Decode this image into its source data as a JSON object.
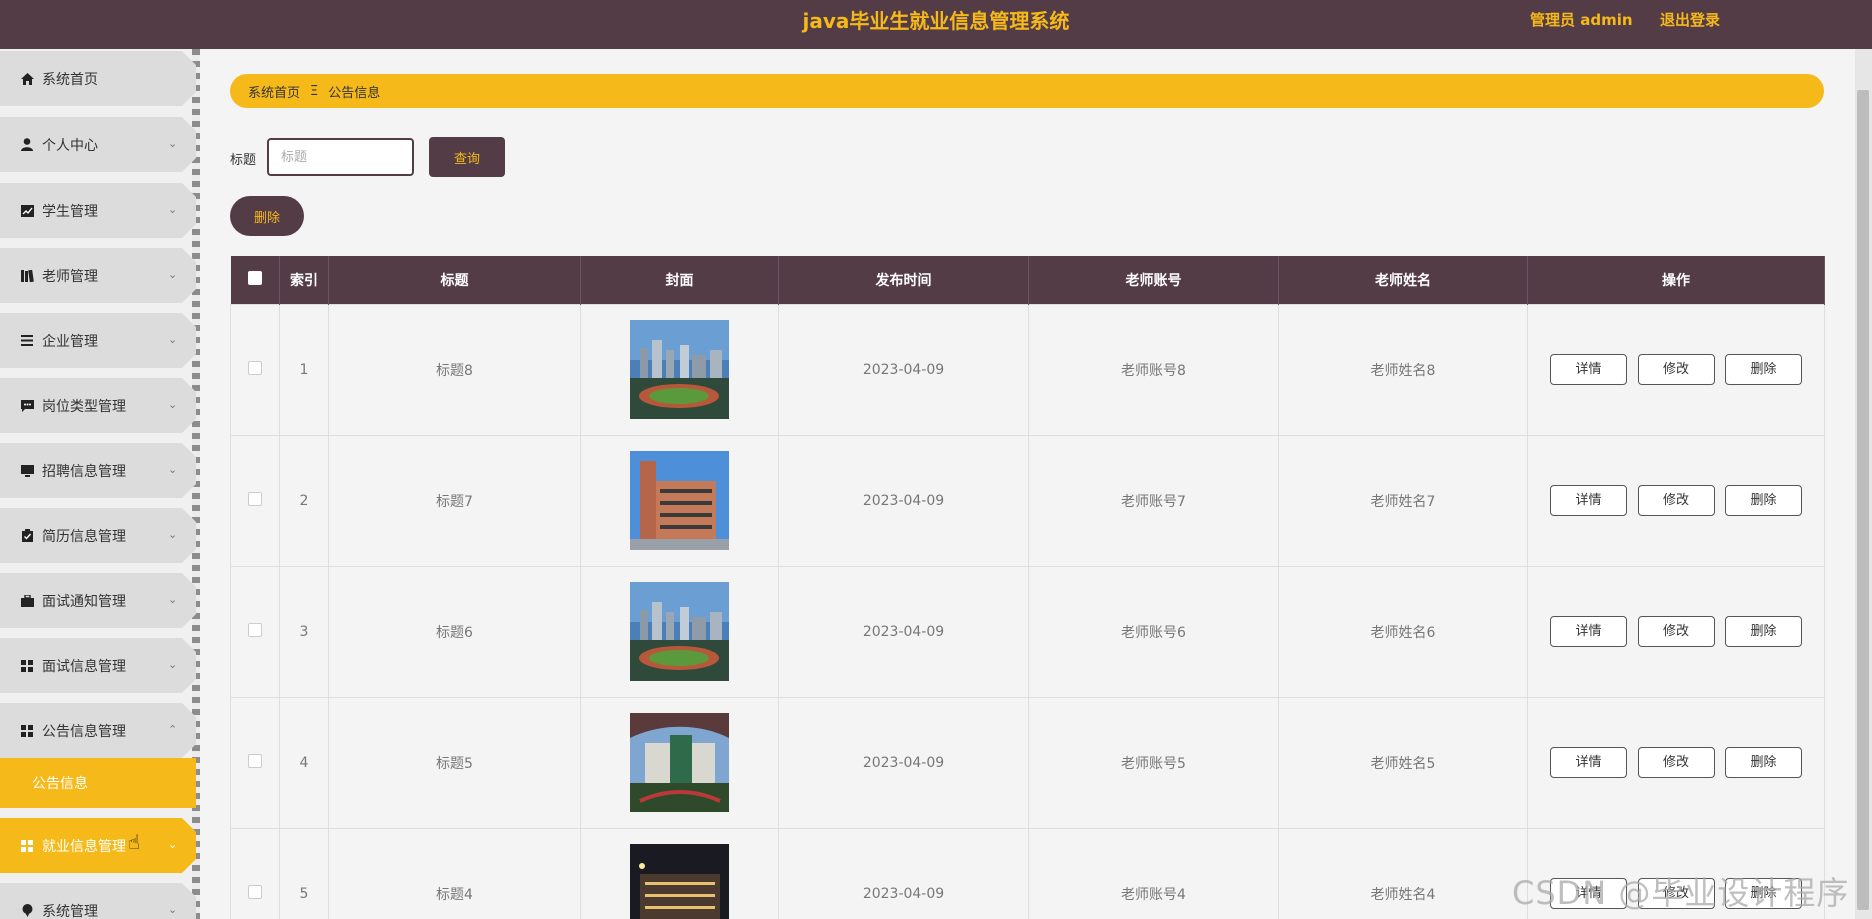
{
  "header": {
    "title": "java毕业生就业信息管理系统",
    "user_label": "管理员 admin",
    "logout_label": "退出登录"
  },
  "sidebar": {
    "items": [
      {
        "label": "系统首页",
        "icon": "home-icon",
        "has_chevron": false
      },
      {
        "label": "个人中心",
        "icon": "user-icon",
        "has_chevron": true
      },
      {
        "label": "学生管理",
        "icon": "chart-icon",
        "has_chevron": true
      },
      {
        "label": "老师管理",
        "icon": "books-icon",
        "has_chevron": true
      },
      {
        "label": "企业管理",
        "icon": "list-icon",
        "has_chevron": true
      },
      {
        "label": "岗位类型管理",
        "icon": "chat-icon",
        "has_chevron": true
      },
      {
        "label": "招聘信息管理",
        "icon": "monitor-icon",
        "has_chevron": true
      },
      {
        "label": "简历信息管理",
        "icon": "clipboard-icon",
        "has_chevron": true
      },
      {
        "label": "面试通知管理",
        "icon": "briefcase-icon",
        "has_chevron": true
      },
      {
        "label": "面试信息管理",
        "icon": "grid-icon",
        "has_chevron": true
      },
      {
        "label": "公告信息管理",
        "icon": "grid-icon",
        "has_chevron": true,
        "expanded": true
      },
      {
        "label": "就业信息管理",
        "icon": "grid-icon",
        "has_chevron": true,
        "highlighted": true
      },
      {
        "label": "系统管理",
        "icon": "pin-icon",
        "has_chevron": true
      }
    ],
    "submenu": {
      "label": "公告信息"
    }
  },
  "breadcrumb": {
    "home": "系统首页",
    "separator": "Ξ",
    "current": "公告信息"
  },
  "search": {
    "label": "标题",
    "placeholder": "标题",
    "button": "查询"
  },
  "bulk_delete": "删除",
  "table": {
    "headers": [
      "索引",
      "标题",
      "封面",
      "发布时间",
      "老师账号",
      "老师姓名",
      "操作"
    ],
    "rows": [
      {
        "index": "1",
        "title": "标题8",
        "date": "2023-04-09",
        "account": "老师账号8",
        "name": "老师姓名8",
        "cover": "city-stadium"
      },
      {
        "index": "2",
        "title": "标题7",
        "date": "2023-04-09",
        "account": "老师账号7",
        "name": "老师姓名7",
        "cover": "brick-building"
      },
      {
        "index": "3",
        "title": "标题6",
        "date": "2023-04-09",
        "account": "老师账号6",
        "name": "老师姓名6",
        "cover": "city-stadium"
      },
      {
        "index": "4",
        "title": "标题5",
        "date": "2023-04-09",
        "account": "老师账号5",
        "name": "老师姓名5",
        "cover": "campus-bridge"
      },
      {
        "index": "5",
        "title": "标题4",
        "date": "2023-04-09",
        "account": "老师账号4",
        "name": "老师姓名4",
        "cover": "night-building"
      }
    ],
    "actions": {
      "detail": "详情",
      "edit": "修改",
      "delete": "删除"
    }
  },
  "watermark": "CSDN @毕业设计程序",
  "colors": {
    "primary": "#543c46",
    "accent": "#f5b919",
    "background": "#f4f4f4"
  }
}
